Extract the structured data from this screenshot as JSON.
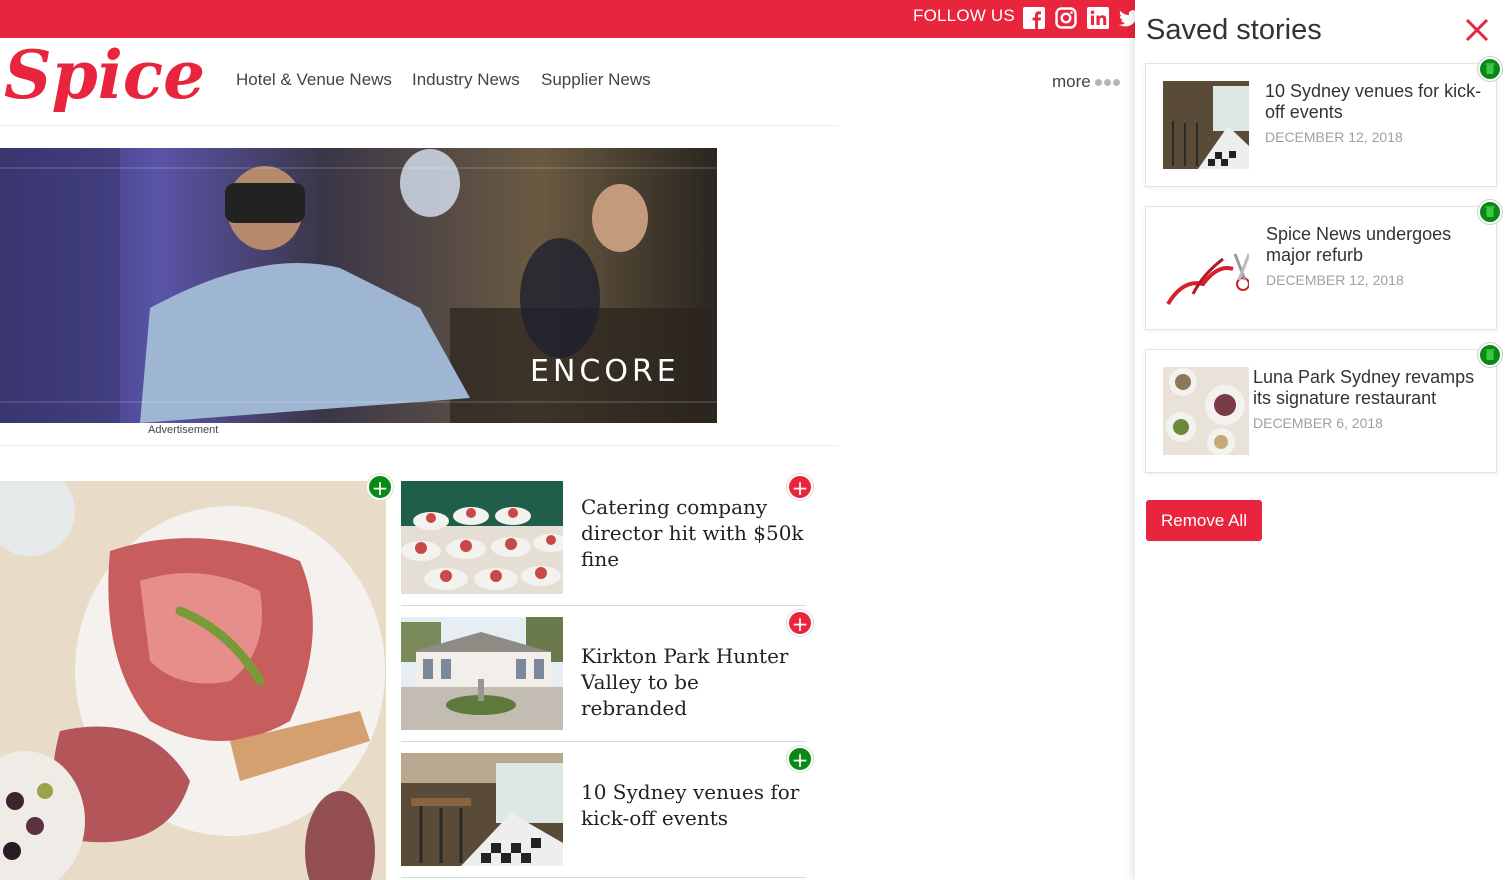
{
  "topbar": {
    "follow_label": "FOLLOW US",
    "social_icons": [
      "facebook-icon",
      "instagram-icon",
      "linkedin-icon",
      "twitter-icon"
    ]
  },
  "header": {
    "logo_text": "Spice",
    "nav": [
      "Hotel & Venue News",
      "Industry News",
      "Supplier News"
    ],
    "more_label": "more"
  },
  "ad": {
    "brand_text": "ENCORE",
    "label": "Advertisement"
  },
  "stories": [
    {
      "title": "Catering company director hit with $50k fine",
      "saved": false
    },
    {
      "title": "Kirkton Park Hunter Valley to be rebranded",
      "saved": false
    },
    {
      "title": "10 Sydney venues for kick-off events",
      "saved": true
    }
  ],
  "feature": {
    "saved": true
  },
  "saved_panel": {
    "title": "Saved stories",
    "items": [
      {
        "title": "10 Sydney venues for kick-off events",
        "date": "DECEMBER 12, 2018"
      },
      {
        "title": "Spice News undergoes major refurb",
        "date": "DECEMBER 12, 2018"
      },
      {
        "title": "Luna Park Sydney revamps its signature restaurant",
        "date": "DECEMBER 6, 2018"
      }
    ],
    "remove_all_label": "Remove All"
  },
  "colors": {
    "brand_red": "#e8253c",
    "saved_green": "#0a8a14"
  }
}
